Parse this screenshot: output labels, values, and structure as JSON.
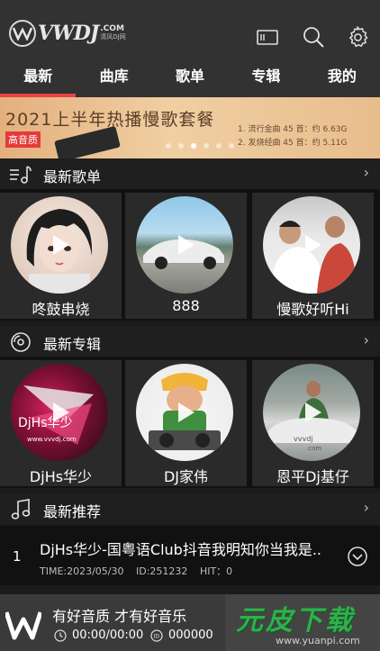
{
  "app": {
    "logo_text": "VWDJ",
    "logo_sub_top": ".COM",
    "logo_sub_bottom": "清风DJ网"
  },
  "header_icons": [
    "sd-card-icon",
    "search-icon",
    "gear-icon"
  ],
  "tabs": [
    {
      "label": "最新",
      "active": true
    },
    {
      "label": "曲库",
      "active": false
    },
    {
      "label": "歌单",
      "active": false
    },
    {
      "label": "专辑",
      "active": false
    },
    {
      "label": "我的",
      "active": false
    }
  ],
  "banner": {
    "title": "2021上半年热播慢歌套餐",
    "badge": "高音质",
    "line1": "1. 流行金曲 45 首：约 6.63G",
    "line2": "2. 发烧经曲 45 首：约 5.11G",
    "slide_count": 6,
    "active_slide": 3
  },
  "sections": {
    "playlists": {
      "title": "最新歌单",
      "items": [
        {
          "label": "咚鼓串烧"
        },
        {
          "label": "888"
        },
        {
          "label": "慢歌好听Hi"
        }
      ]
    },
    "albums": {
      "title": "最新专辑",
      "items": [
        {
          "label": "DjHs华少",
          "cover_text": "DjHs华少",
          "cover_url": "www.vvvdj.com"
        },
        {
          "label": "DJ家伟"
        },
        {
          "label": "恩平Dj基仔",
          "cover_text": "vvvdj",
          "cover_url": ".com"
        }
      ]
    },
    "recommend": {
      "title": "最新推荐",
      "items": [
        {
          "num": "1",
          "title": "DjHs华少-国粤语Club抖音我明知你当我是..",
          "time": "TIME:2023/05/30",
          "id": "ID:251232",
          "hit": "HIT：0"
        }
      ]
    }
  },
  "player": {
    "slogan": "有好音质 才有好音乐",
    "time": "00:00/00:00",
    "id": "000000"
  },
  "watermark": {
    "text": "元皮下载",
    "url": "www.yuanpi.com"
  },
  "colors": {
    "accent": "#e94244",
    "topbar": "#323232",
    "background": "#1b1b1b",
    "watermark_green": "#2fb04b"
  }
}
